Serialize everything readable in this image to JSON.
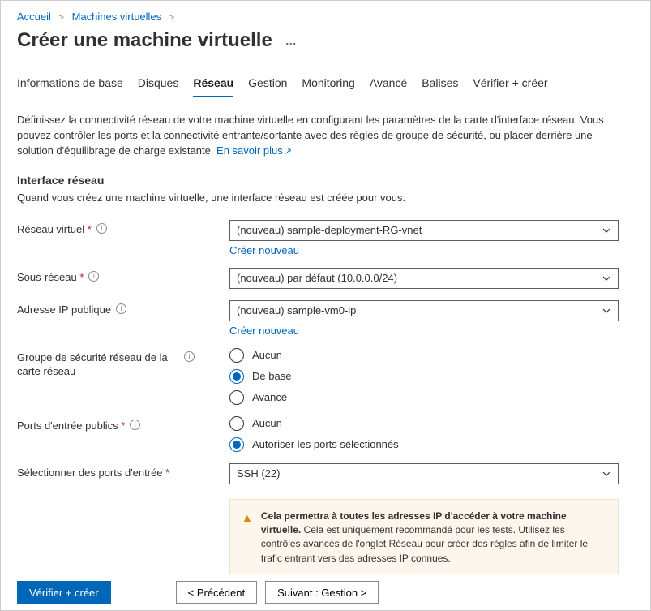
{
  "breadcrumb": {
    "home": "Accueil",
    "vms": "Machines virtuelles"
  },
  "page_title": "Créer une machine virtuelle",
  "more_indicator": "…",
  "tabs": {
    "basics": "Informations de base",
    "disks": "Disques",
    "network": "Réseau",
    "management": "Gestion",
    "monitoring": "Monitoring",
    "advanced": "Avancé",
    "tags": "Balises",
    "review": "Vérifier + créer"
  },
  "description_text": "Définissez la connectivité réseau de votre machine virtuelle en configurant les paramètres de la carte d'interface réseau. Vous pouvez contrôler les ports et la connectivité entrante/sortante avec des règles de groupe de sécurité, ou placer derrière une solution d'équilibrage de charge existante. ",
  "learn_more": "En savoir plus",
  "section": {
    "heading": "Interface réseau",
    "subtext": "Quand vous créez une machine virtuelle, une interface réseau est créée pour vous."
  },
  "form": {
    "vnet": {
      "label": "Réseau virtuel",
      "value": "(nouveau) sample-deployment-RG-vnet",
      "create_new": "Créer nouveau"
    },
    "subnet": {
      "label": "Sous-réseau",
      "value": "(nouveau) par défaut (10.0.0.0/24)"
    },
    "public_ip": {
      "label": "Adresse IP publique",
      "value": "(nouveau) sample-vm0-ip",
      "create_new": "Créer nouveau"
    },
    "nsg": {
      "label": "Groupe de sécurité réseau de la carte réseau",
      "options": {
        "none": "Aucun",
        "basic": "De base",
        "advanced": "Avancé"
      },
      "selected": "basic"
    },
    "inbound_ports": {
      "label": "Ports d'entrée publics",
      "options": {
        "none": "Aucun",
        "allow": "Autoriser les ports sélectionnés"
      },
      "selected": "allow"
    },
    "select_ports": {
      "label": "Sélectionner des ports d'entrée",
      "value": "SSH (22)"
    }
  },
  "warning": {
    "bold": "Cela permettra à toutes les adresses IP d'accéder à votre machine virtuelle.",
    "rest": " Cela est uniquement recommandé pour les tests. Utilisez les contrôles avancés de l'onglet Réseau pour créer des règles afin de limiter le trafic entrant vers des adresses IP connues."
  },
  "footer": {
    "review": "Vérifier + créer",
    "previous": "<  Précédent",
    "next": "Suivant : Gestion  >"
  }
}
